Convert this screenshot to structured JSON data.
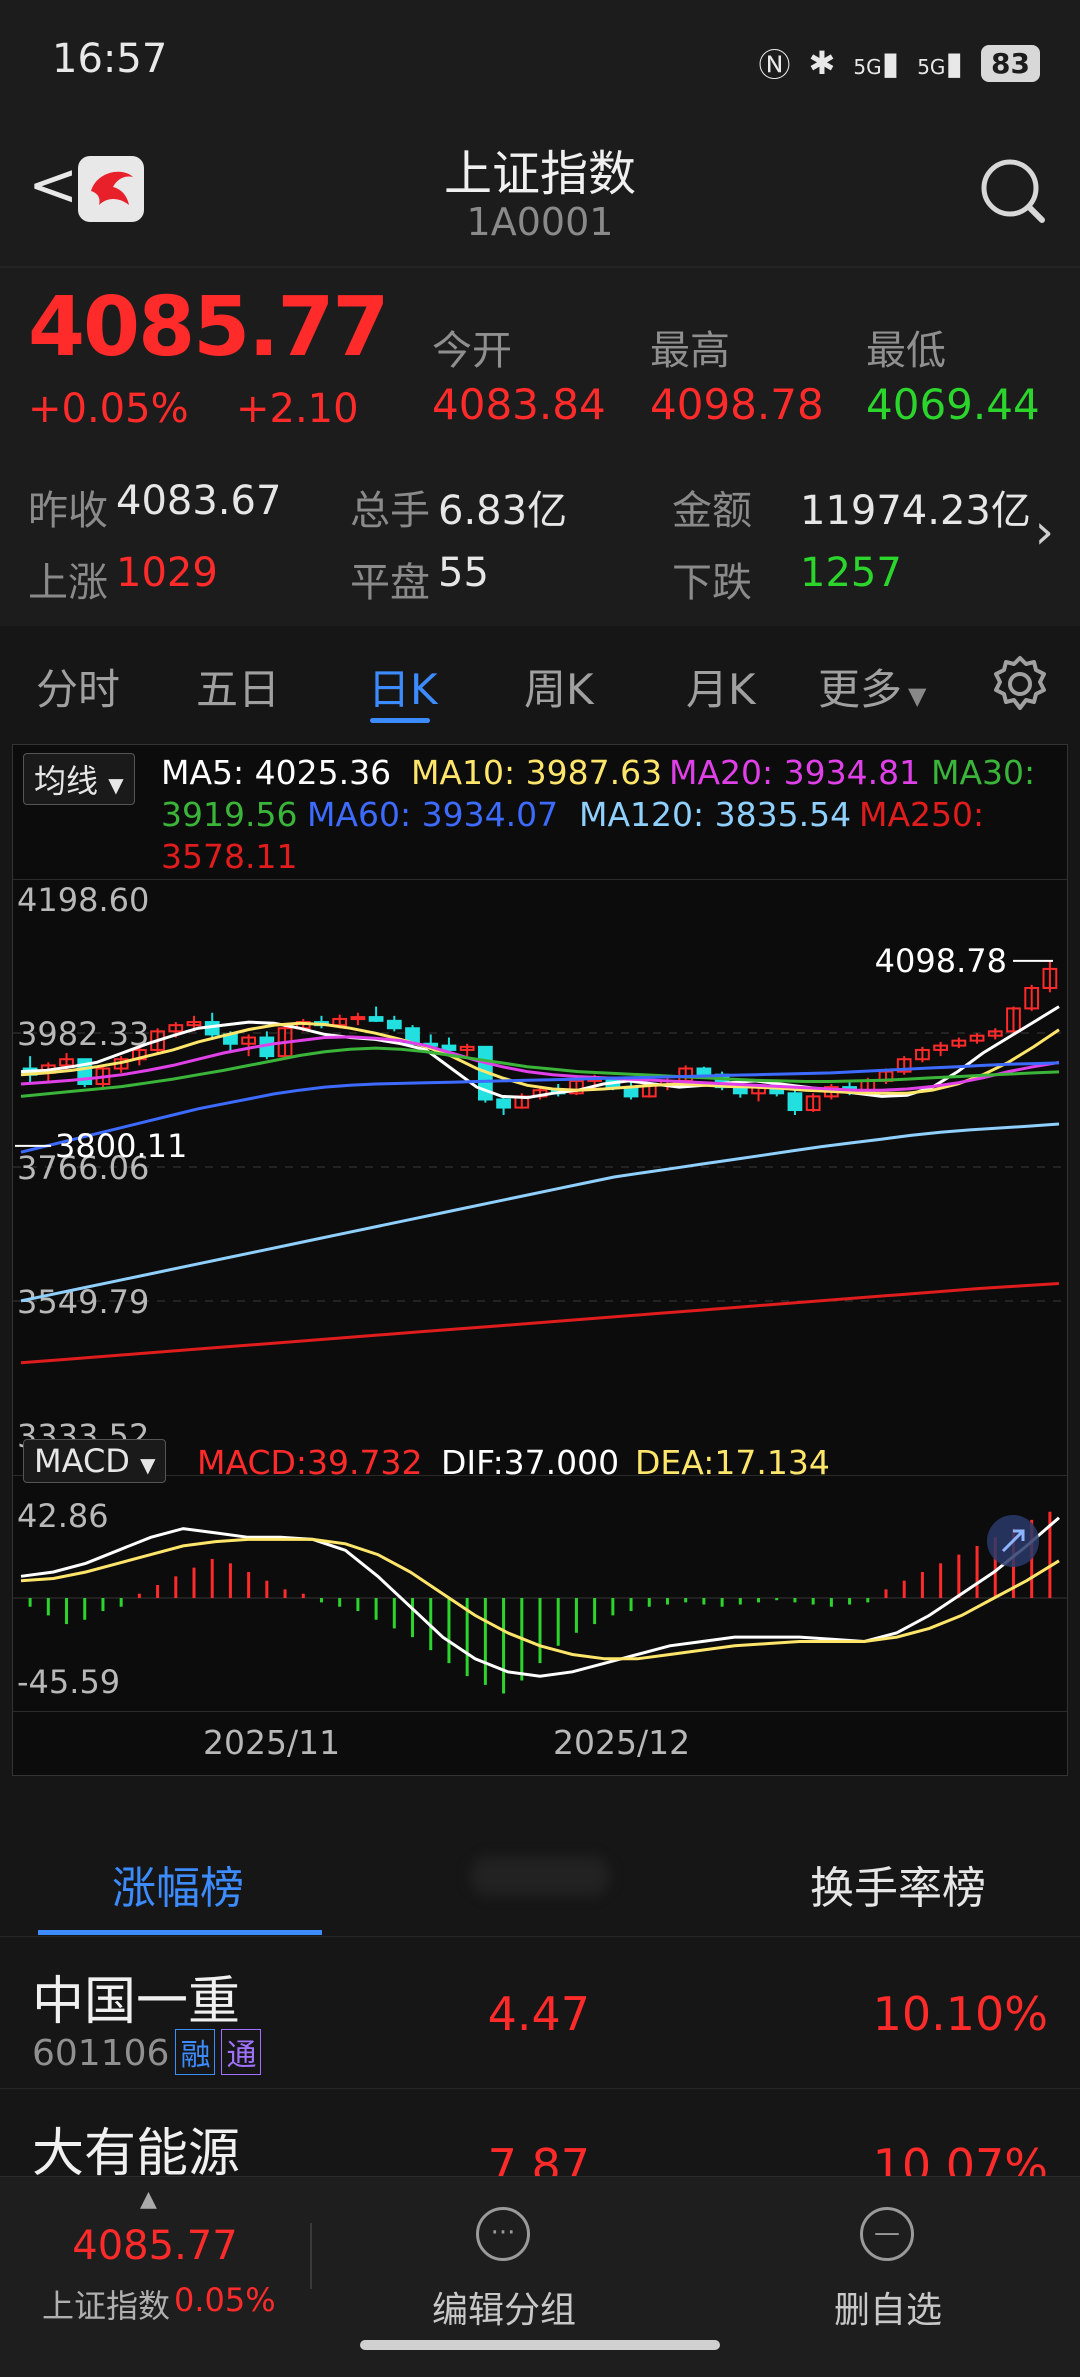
{
  "status": {
    "time": "16:57",
    "signal1": "5G",
    "signal2": "5G",
    "battery": "83"
  },
  "header": {
    "title": "上证指数",
    "code": "1A0001"
  },
  "quote": {
    "price": "4085.77",
    "pct": "+0.05%",
    "change": "+2.10",
    "open_label": "今开",
    "open": "4083.84",
    "high_label": "最高",
    "high": "4098.78",
    "low_label": "最低",
    "low": "4069.44",
    "prev_label": "昨收",
    "prev": "4083.67",
    "vol_label": "总手",
    "vol": "6.83亿",
    "amt_label": "金额",
    "amt": "11974.23亿",
    "up_label": "上涨",
    "up": "1029",
    "flat_label": "平盘",
    "flat": "55",
    "down_label": "下跌",
    "down": "1257"
  },
  "tabs": [
    "分时",
    "五日",
    "日K",
    "周K",
    "月K",
    "更多"
  ],
  "active_tab": "日K",
  "chart": {
    "ma_selector": "均线",
    "ma": {
      "ma5": "MA5: 4025.36",
      "ma10": "MA10: 3987.63",
      "ma20": "MA20: 3934.81",
      "ma30": "MA30:",
      "ma30v": "3919.56",
      "ma60": "MA60: 3934.07",
      "ma120": "MA120: 3835.54",
      "ma250": "MA250:",
      "ma250v": "3578.11"
    },
    "y_labels": [
      "4198.60",
      "3982.33",
      "3766.06",
      "3549.79",
      "3333.52"
    ],
    "high_marker": "4098.78",
    "low_marker": "3800.11",
    "macd_selector": "MACD",
    "macd": {
      "macd": "MACD:39.732",
      "dif": "DIF:37.000",
      "dea": "DEA:17.134"
    },
    "macd_y": [
      "42.86",
      "-45.59"
    ],
    "x_labels": [
      "2025/11",
      "2025/12"
    ]
  },
  "chart_data": {
    "type": "candlestick",
    "y_range": [
      3333.52,
      4198.6
    ],
    "candles": [
      [
        3925,
        3945,
        3900,
        3915
      ],
      [
        3918,
        3935,
        3905,
        3930
      ],
      [
        3930,
        3950,
        3920,
        3940
      ],
      [
        3940,
        3935,
        3895,
        3900
      ],
      [
        3900,
        3930,
        3892,
        3925
      ],
      [
        3925,
        3945,
        3918,
        3940
      ],
      [
        3940,
        3960,
        3930,
        3955
      ],
      [
        3955,
        3990,
        3950,
        3985
      ],
      [
        3985,
        4000,
        3975,
        3995
      ],
      [
        3995,
        4010,
        3985,
        4000
      ],
      [
        4000,
        4015,
        3975,
        3980
      ],
      [
        3980,
        3985,
        3950,
        3965
      ],
      [
        3965,
        3980,
        3945,
        3975
      ],
      [
        3975,
        3985,
        3940,
        3945
      ],
      [
        3945,
        3995,
        3940,
        3990
      ],
      [
        3990,
        4005,
        3985,
        4000
      ],
      [
        4000,
        4010,
        3990,
        3995
      ],
      [
        3995,
        4012,
        3990,
        4005
      ],
      [
        4005,
        4015,
        3995,
        4008
      ],
      [
        4008,
        4025,
        4000,
        4002
      ],
      [
        4002,
        4010,
        3985,
        3990
      ],
      [
        3990,
        3995,
        3958,
        3965
      ],
      [
        3965,
        3980,
        3955,
        3962
      ],
      [
        3962,
        3975,
        3950,
        3955
      ],
      [
        3955,
        3965,
        3945,
        3960
      ],
      [
        3960,
        3950,
        3870,
        3875
      ],
      [
        3875,
        3880,
        3850,
        3862
      ],
      [
        3862,
        3885,
        3860,
        3880
      ],
      [
        3880,
        3895,
        3875,
        3890
      ],
      [
        3890,
        3900,
        3880,
        3885
      ],
      [
        3885,
        3910,
        3882,
        3905
      ],
      [
        3905,
        3915,
        3892,
        3910
      ],
      [
        3910,
        3912,
        3890,
        3895
      ],
      [
        3895,
        3905,
        3875,
        3880
      ],
      [
        3880,
        3900,
        3878,
        3898
      ],
      [
        3898,
        3915,
        3890,
        3905
      ],
      [
        3905,
        3930,
        3900,
        3925
      ],
      [
        3925,
        3928,
        3910,
        3915
      ],
      [
        3915,
        3920,
        3890,
        3895
      ],
      [
        3895,
        3900,
        3878,
        3885
      ],
      [
        3885,
        3900,
        3872,
        3898
      ],
      [
        3898,
        3905,
        3880,
        3885
      ],
      [
        3885,
        3890,
        3850,
        3858
      ],
      [
        3858,
        3885,
        3855,
        3880
      ],
      [
        3880,
        3900,
        3875,
        3895
      ],
      [
        3895,
        3905,
        3882,
        3890
      ],
      [
        3890,
        3910,
        3885,
        3905
      ],
      [
        3905,
        3925,
        3900,
        3920
      ],
      [
        3920,
        3945,
        3915,
        3940
      ],
      [
        3940,
        3960,
        3935,
        3955
      ],
      [
        3955,
        3968,
        3945,
        3962
      ],
      [
        3962,
        3975,
        3958,
        3970
      ],
      [
        3970,
        3982,
        3965,
        3978
      ],
      [
        3978,
        3990,
        3972,
        3985
      ],
      [
        3985,
        4025,
        3980,
        4022
      ],
      [
        4022,
        4060,
        4018,
        4055
      ],
      [
        4055,
        4098.78,
        4048,
        4085.77
      ]
    ],
    "series": [
      {
        "name": "MA5",
        "color": "#ffffff",
        "values": [
          3920,
          3922,
          3928,
          3935,
          3950,
          3965,
          3978,
          3990,
          3995,
          4000,
          3998,
          3990,
          3980,
          3975,
          3972,
          3965,
          3955,
          3925,
          3895,
          3880,
          3878,
          3885,
          3890,
          3900,
          3905,
          3900,
          3895,
          3898,
          3902,
          3905,
          3900,
          3895,
          3890,
          3885,
          3880,
          3882,
          3895,
          3920,
          3950,
          3975,
          4000,
          4025
        ]
      },
      {
        "name": "MA10",
        "color": "#ffe66b",
        "values": [
          3915,
          3918,
          3922,
          3928,
          3935,
          3945,
          3955,
          3968,
          3978,
          3988,
          3995,
          3998,
          3996,
          3990,
          3982,
          3972,
          3960,
          3945,
          3925,
          3910,
          3898,
          3892,
          3890,
          3892,
          3895,
          3898,
          3900,
          3898,
          3896,
          3895,
          3893,
          3890,
          3888,
          3886,
          3885,
          3885,
          3890,
          3900,
          3915,
          3935,
          3960,
          3987.63
        ]
      },
      {
        "name": "MA20",
        "color": "#e040e8",
        "values": [
          3900,
          3903,
          3906,
          3910,
          3915,
          3922,
          3930,
          3940,
          3950,
          3958,
          3965,
          3970,
          3975,
          3976,
          3974,
          3970,
          3962,
          3950,
          3938,
          3928,
          3920,
          3915,
          3912,
          3910,
          3908,
          3906,
          3904,
          3902,
          3900,
          3898,
          3896,
          3894,
          3892,
          3890,
          3890,
          3892,
          3896,
          3902,
          3910,
          3920,
          3928,
          3934.81
        ]
      },
      {
        "name": "MA30",
        "color": "#3ab53a",
        "values": [
          3880,
          3884,
          3888,
          3892,
          3896,
          3902,
          3908,
          3915,
          3922,
          3930,
          3938,
          3946,
          3952,
          3956,
          3958,
          3956,
          3952,
          3946,
          3940,
          3934,
          3928,
          3924,
          3920,
          3918,
          3916,
          3914,
          3912,
          3910,
          3908,
          3906,
          3905,
          3904,
          3904,
          3905,
          3906,
          3908,
          3910,
          3912,
          3914,
          3916,
          3918,
          3919.56
        ]
      },
      {
        "name": "MA60",
        "color": "#3d6bff",
        "values": [
          3790,
          3800,
          3810,
          3820,
          3830,
          3840,
          3850,
          3860,
          3868,
          3876,
          3884,
          3890,
          3895,
          3898,
          3900,
          3901,
          3902,
          3903,
          3904,
          3905,
          3906,
          3907,
          3908,
          3909,
          3910,
          3911,
          3912,
          3913,
          3914,
          3915,
          3916,
          3917,
          3918,
          3920,
          3922,
          3924,
          3926,
          3928,
          3930,
          3932,
          3933,
          3934.07
        ]
      },
      {
        "name": "MA120",
        "color": "#8fd0ff",
        "values": [
          3550,
          3560,
          3570,
          3580,
          3590,
          3600,
          3610,
          3620,
          3630,
          3640,
          3650,
          3660,
          3670,
          3680,
          3690,
          3700,
          3710,
          3720,
          3730,
          3740,
          3750,
          3757,
          3764,
          3771,
          3778,
          3785,
          3792,
          3799,
          3805,
          3811,
          3817,
          3822,
          3826,
          3829,
          3832,
          3835.54
        ]
      },
      {
        "name": "MA250",
        "color": "#e01c1c",
        "values": [
          3450,
          3455,
          3460,
          3465,
          3470,
          3475,
          3480,
          3485,
          3490,
          3495,
          3500,
          3505,
          3510,
          3515,
          3520,
          3525,
          3530,
          3535,
          3540,
          3545,
          3550,
          3555,
          3560,
          3565,
          3570,
          3574,
          3578.11
        ]
      }
    ],
    "macd_range": [
      -45.59,
      42.86
    ],
    "macd_hist": [
      -4,
      -8,
      -12,
      -10,
      -6,
      -4,
      2,
      6,
      10,
      14,
      18,
      16,
      12,
      8,
      4,
      2,
      -2,
      -4,
      -6,
      -10,
      -14,
      -18,
      -24,
      -30,
      -36,
      -40,
      -44,
      -38,
      -30,
      -22,
      -16,
      -12,
      -8,
      -6,
      -4,
      -3,
      -2,
      -3,
      -4,
      -3,
      -2,
      -1,
      -2,
      -3,
      -4,
      -3,
      -2,
      4,
      8,
      12,
      16,
      20,
      24,
      28,
      32,
      36,
      39.732
    ],
    "dif": [
      10,
      12,
      16,
      22,
      28,
      32,
      30,
      28,
      28,
      27,
      22,
      10,
      -4,
      -18,
      -28,
      -34,
      -36,
      -34,
      -30,
      -26,
      -22,
      -20,
      -18,
      -18,
      -18,
      -19,
      -20,
      -16,
      -8,
      2,
      12,
      24,
      37.0
    ],
    "dea": [
      8,
      9,
      12,
      16,
      20,
      24,
      26,
      27,
      27,
      27,
      25,
      20,
      12,
      2,
      -8,
      -16,
      -22,
      -26,
      -28,
      -28,
      -26,
      -24,
      -22,
      -21,
      -20,
      -20,
      -20,
      -18,
      -14,
      -8,
      0,
      8,
      17.134
    ]
  },
  "rankings": {
    "tabs": [
      "涨幅榜",
      "换手率榜"
    ],
    "rows": [
      {
        "name": "中国一重",
        "code": "601106",
        "b1": "融",
        "b2": "通",
        "price": "4.47",
        "pct": "10.10%"
      },
      {
        "name": "大有能源",
        "code": "",
        "b1": "",
        "b2": "",
        "price": "7.87",
        "pct": "10.07%"
      }
    ]
  },
  "bottom": {
    "price": "4085.77",
    "name": "上证指数",
    "pct": "0.05%",
    "edit_label": "编辑分组",
    "delete_label": "删自选"
  },
  "colors": {
    "up": "#ff2a2a",
    "down": "#2cd52c",
    "accent": "#3c8cff"
  }
}
